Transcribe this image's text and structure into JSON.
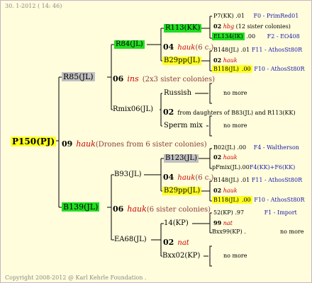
{
  "header": {
    "date": "30.  1-2012 ( 14: 46)"
  },
  "footer": {
    "copyright": "Copyright 2008-2012 @ Karl Kehrle Foundation ."
  },
  "colors": {
    "gray": "#c0c0c0",
    "green": "#22dd22",
    "yellow": "#ffff22",
    "year_red": "#cc0000",
    "blue_text": "#1a1aaa"
  },
  "root": {
    "name": "P150(PJ)",
    "year": "09",
    "breeder": "hauk",
    "note": "(Drones from 6 sister colonies)"
  },
  "gen1": {
    "top": {
      "name": "R85(JL)",
      "year": "06",
      "breeder": "ins",
      "note": "(2x3 sister colonies)"
    },
    "bottom": {
      "name": "B139(JL)",
      "year": "06",
      "breeder": "hauk",
      "note": "(6 sister colonies)"
    }
  },
  "gen2": {
    "a": {
      "name": "R84(JL)",
      "year": "04",
      "breeder": "hauk",
      "note": "(6 c.)"
    },
    "b": {
      "name": "Rmix06(JL)",
      "year": "02",
      "note": "from daughters of B83(JL) and R113(KK)"
    },
    "c": {
      "name": "B93(JL)",
      "year": "04",
      "breeder": "hauk",
      "note": "(6 c.)"
    },
    "d": {
      "name": "EA68(JL)",
      "year": "02",
      "breeder": "nat"
    }
  },
  "gen3": {
    "r113": "R113(KK)",
    "b29a": "B29pp(JL)",
    "russish": "Russish",
    "sperm": "Sperm mix",
    "b123": "B123(JL)",
    "b29b": "B29pp(JL)",
    "kp14": "14(KP)",
    "bxx02": "Bxx02(KP)"
  },
  "gen4": {
    "p7": {
      "name": "P7(KK)",
      "year": ".01",
      "note": "F0 - PrimRed01"
    },
    "p7_sub": {
      "year": "02",
      "breeder": "hbg",
      "note": "(12 sister colonies)"
    },
    "el134": {
      "name": "EL134(IK)",
      "year": ".00",
      "note": "F2 - EO408"
    },
    "b148a": {
      "name": "B148(JL)",
      "year": ".01",
      "note": "F11 - AthosSt80R"
    },
    "b148a_sub": {
      "year": "02",
      "breeder": "hauk"
    },
    "b118a": {
      "name": "B118(JL)",
      "year": ".00",
      "note": "F10 - AthosSt80R"
    },
    "nomore": "no more",
    "b02": {
      "name": "B02(JL)",
      "year": ".00",
      "note": "F4 - Waltherson"
    },
    "b02_sub": {
      "year": "02",
      "breeder": "hauk"
    },
    "pfmix": {
      "name": "pFmix(JL)",
      "year": ".00",
      "note": "F4(KK)+F6(KK)"
    },
    "b148b": {
      "name": "B148(JL)",
      "year": ".01",
      "note": "F11 - AthosSt80R"
    },
    "b148b_sub": {
      "year": "02",
      "breeder": "hauk"
    },
    "b118b": {
      "name": "B118(JL)",
      "year": ".00",
      "note": "F10 - AthosSt80R"
    },
    "kp52": {
      "name": "52(KP)",
      "year": ".97",
      "note": "F1 - Import"
    },
    "kp52_sub": {
      "year": "99",
      "breeder": "nat"
    },
    "bxx99": {
      "name": "Bxx99(KP)",
      "year": "."
    }
  }
}
